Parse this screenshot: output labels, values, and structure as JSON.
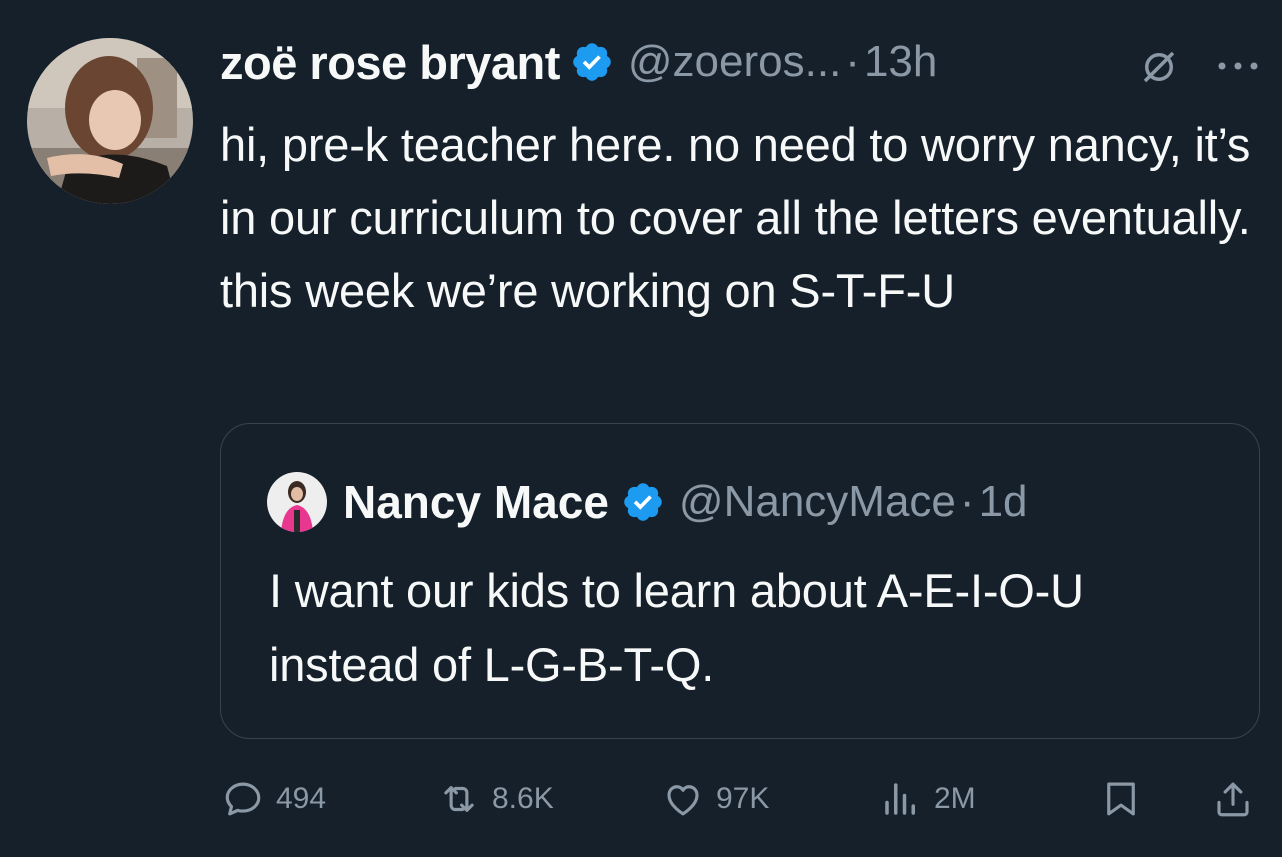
{
  "tweet": {
    "author_name": "zoë rose bryant",
    "handle": "@zoeros...",
    "separator": "·",
    "time": "13h",
    "text": "hi, pre-k teacher here. no need to worry nancy, it’s in our curriculum to cover all the letters eventually. this week we’re working on S-T-F-U",
    "verified": true
  },
  "quoted_tweet": {
    "author_name": "Nancy Mace",
    "handle": "@NancyMace",
    "separator": "·",
    "time": "1d",
    "text": "I want our kids to learn about A-E-I-O-U instead of L-G-B-T-Q.",
    "verified": true
  },
  "actions": {
    "replies": "494",
    "retweets": "8.6K",
    "likes": "97K",
    "views": "2M"
  },
  "colors": {
    "background": "#15202b",
    "text": "#f7f9f9",
    "secondary": "#8b98a5",
    "verified": "#1d9bf0",
    "border": "#38444d"
  },
  "icons": [
    "verified-badge-icon",
    "grok-icon",
    "more-icon",
    "reply-icon",
    "retweet-icon",
    "like-icon",
    "views-icon",
    "bookmark-icon",
    "share-icon"
  ]
}
